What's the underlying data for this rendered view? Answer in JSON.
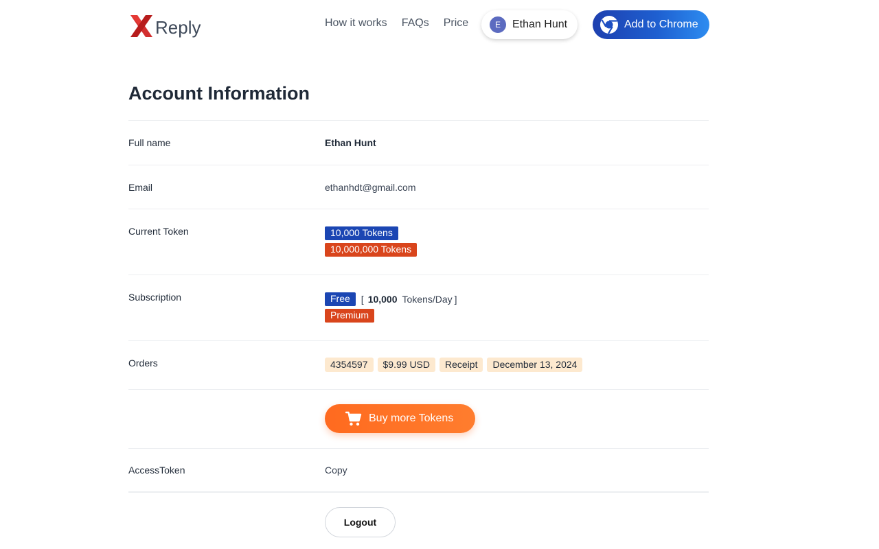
{
  "header": {
    "logo_text": "Reply",
    "nav": [
      "How it works",
      "FAQs",
      "Price"
    ],
    "user": {
      "initial": "E",
      "name": "Ethan Hunt"
    },
    "chrome_button": "Add to Chrome"
  },
  "page_title": "Account Information",
  "rows": {
    "full_name": {
      "label": "Full name",
      "value": "Ethan Hunt"
    },
    "email": {
      "label": "Email",
      "value": "ethanhdt@gmail.com"
    },
    "current_token": {
      "label": "Current Token",
      "badges": [
        "10,000 Tokens",
        "10,000,000 Tokens"
      ]
    },
    "subscription": {
      "label": "Subscription",
      "free_badge": "Free",
      "bracket_open": "[",
      "daily_amount": "10,000",
      "daily_unit": "Tokens/Day",
      "bracket_close": "]",
      "premium_badge": "Premium"
    },
    "orders": {
      "label": "Orders",
      "items": [
        "4354597",
        "$9.99 USD",
        "Receipt",
        "December 13, 2024"
      ]
    },
    "buy_button": "Buy more Tokens",
    "access_token": {
      "label": "AccessToken",
      "value": "Copy"
    },
    "logout_button": "Logout"
  },
  "colors": {
    "primary_blue": "#1b46b3",
    "accent_red": "#d9451c",
    "accent_orange": "#ff6a1f",
    "order_bg": "#fde9cf"
  }
}
